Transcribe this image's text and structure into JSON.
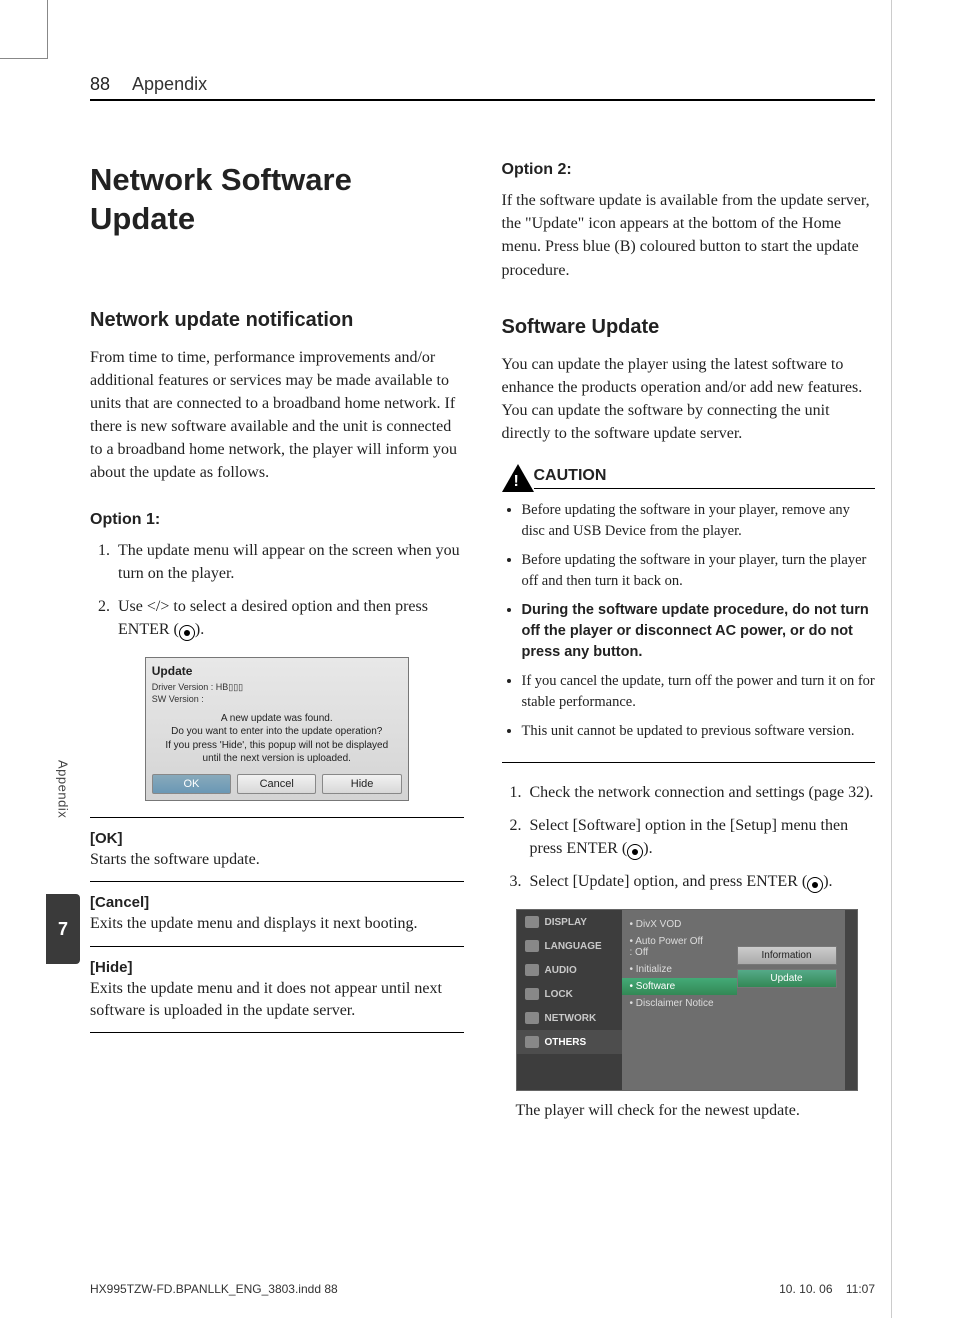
{
  "header": {
    "page_num": "88",
    "section": "Appendix"
  },
  "sidebar": {
    "label": "Appendix",
    "chapter": "7"
  },
  "left": {
    "title": "Network Software Update",
    "h2": "Network update notification",
    "intro": "From time to time, performance improvements and/or additional features or services may be made available to units that are connected to a broadband home network. If there is new software available and the unit is connected to a broadband home network, the player will inform you about the update as follows.",
    "opt1_h": "Option 1:",
    "opt1_steps": [
      "The update menu will appear on the screen when you turn on the player.",
      "Use </> to select a desired option and then press ENTER ("
    ],
    "dlg": {
      "title": "Update",
      "meta1": "Driver Version : HB▯▯▯",
      "meta2": "SW Version :",
      "msg": "A new update was found.\nDo you want to enter into the update operation?\nIf you press 'Hide', this popup will not be displayed\nuntil the next version is uploaded.",
      "ok": "OK",
      "cancel": "Cancel",
      "hide": "Hide"
    },
    "defs": [
      {
        "t": "[OK]",
        "b": "Starts the software update."
      },
      {
        "t": "[Cancel]",
        "b": "Exits the update menu and displays it next booting."
      },
      {
        "t": "[Hide]",
        "b": "Exits the update menu and it does not appear until next software is uploaded in the update server."
      }
    ]
  },
  "right": {
    "opt2_h": "Option 2:",
    "opt2_p": "If the software update is available from the update server, the \"Update\" icon appears at the bottom of the Home menu. Press blue (B) coloured button to start the update procedure.",
    "h2": "Software Update",
    "p1": "You can update the player using the latest software to enhance the products operation and/or add new features. You can update the software by connecting the unit directly to the software update server.",
    "caution_label": "CAUTION",
    "caution": [
      "Before updating the software in your player, remove any disc and USB Device from the player.",
      "Before updating the software in your player, turn the player off and then turn it back on.",
      "During the software update procedure, do not turn off the player or disconnect AC power, or do not press any button.",
      "If you cancel the update, turn off the power and turn it on for stable performance.",
      "This unit cannot be updated to previous software version."
    ],
    "steps": [
      "Check the network connection and settings (page 32).",
      "Select [Software] option in the [Setup] menu then press ENTER (",
      "Select [Update] option, and press ENTER ("
    ],
    "menu": {
      "left": [
        "DISPLAY",
        "LANGUAGE",
        "AUDIO",
        "LOCK",
        "NETWORK",
        "OTHERS"
      ],
      "mid": [
        {
          "t": "• DivX VOD"
        },
        {
          "t": "• Auto Power Off",
          "v": ": Off"
        },
        {
          "t": "• Initialize"
        },
        {
          "t": "• Software",
          "sel": true
        },
        {
          "t": "• Disclaimer Notice"
        }
      ],
      "right": [
        "Information",
        "Update"
      ],
      "caption": "The player will check for the newest update."
    }
  },
  "footer": {
    "file": "HX995TZW-FD.BPANLLK_ENG_3803.indd   88",
    "date": "10. 10. 06",
    "time": "11:07"
  }
}
